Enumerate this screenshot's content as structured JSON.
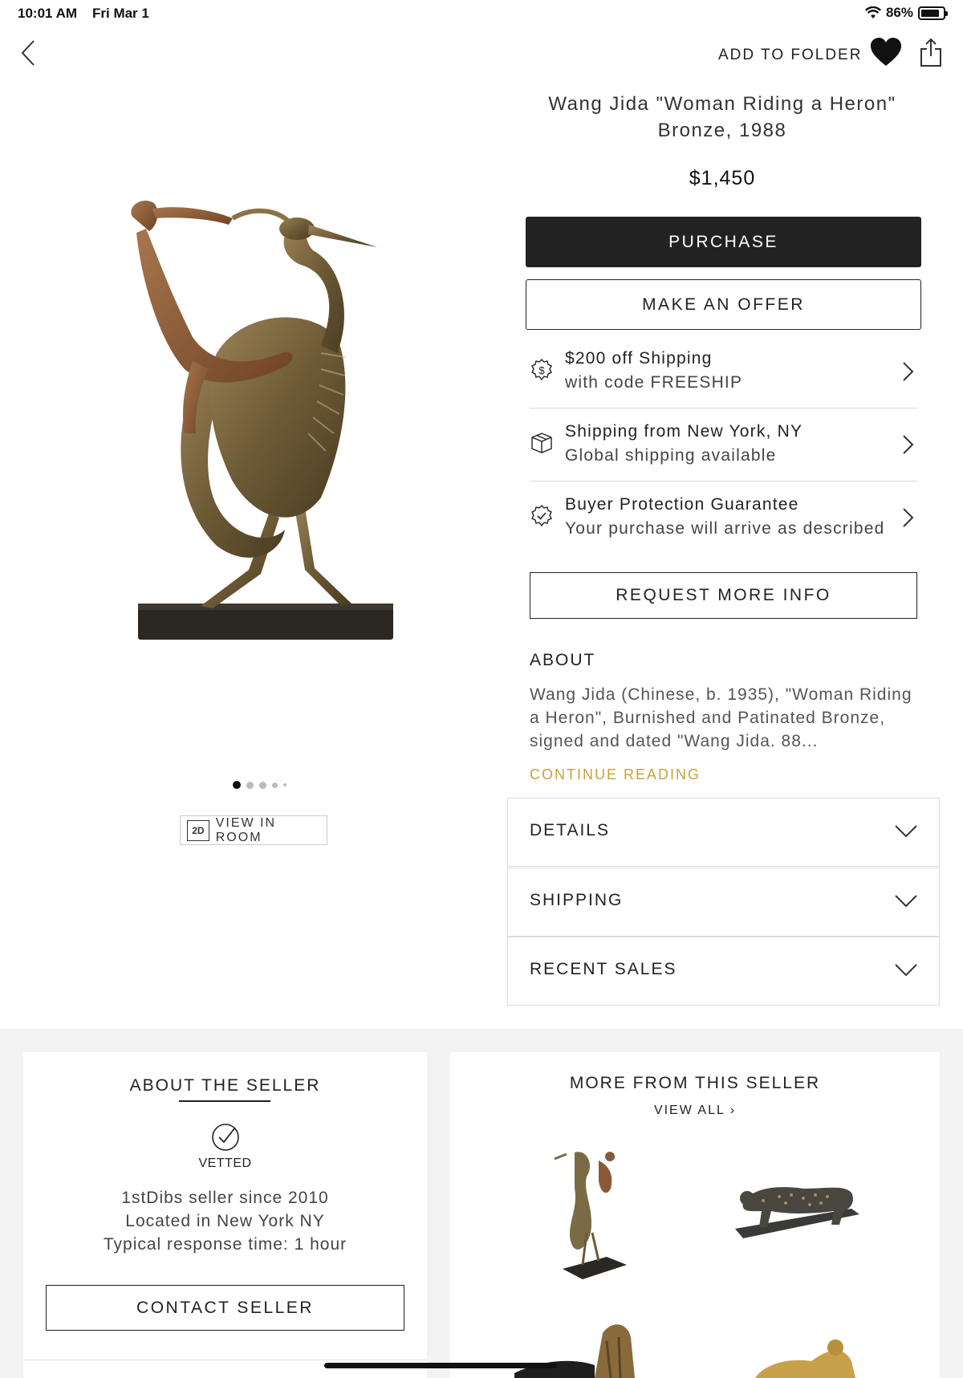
{
  "status_bar": {
    "time": "10:01 AM",
    "date": "Fri Mar 1",
    "battery": "86%",
    "battery_level": 0.86
  },
  "nav": {
    "add_to_folder": "ADD TO FOLDER",
    "back_icon": "chevron-left-icon",
    "favorite_icon": "heart-icon",
    "share_icon": "share-icon"
  },
  "product": {
    "title_line1": "Wang Jida \"Woman Riding a Heron\"",
    "title_line2": "Bronze, 1988",
    "price": "$1,450",
    "purchase_label": "PURCHASE",
    "offer_label": "MAKE AN OFFER"
  },
  "gallery": {
    "page_count": 5,
    "active_index": 0,
    "view_in_room_badge": "2D",
    "view_in_room_label": "VIEW IN ROOM"
  },
  "info_rows": [
    {
      "icon": "dollar-badge-icon",
      "title": "$200 off Shipping",
      "subtitle": "with code FREESHIP"
    },
    {
      "icon": "box-icon",
      "title": "Shipping from New York, NY",
      "subtitle": "Global shipping available"
    },
    {
      "icon": "check-badge-icon",
      "title": "Buyer Protection Guarantee",
      "subtitle": "Your purchase will arrive as described"
    }
  ],
  "request_info_label": "REQUEST MORE INFO",
  "about": {
    "heading": "ABOUT",
    "text": "Wang Jida (Chinese, b. 1935), \"Woman Riding a Heron\", Burnished and Patinated Bronze, signed and dated \"Wang Jida. 88...",
    "continue_label": "CONTINUE READING"
  },
  "accordions": [
    {
      "label": "DETAILS"
    },
    {
      "label": "SHIPPING"
    },
    {
      "label": "RECENT SALES"
    }
  ],
  "seller": {
    "heading": "ABOUT THE SELLER",
    "vetted_label": "VETTED",
    "since": "1stDibs seller since 2010",
    "location": "Located in New York NY",
    "response_time": "Typical response time: 1 hour",
    "contact_label": "CONTACT SELLER"
  },
  "more_from_seller": {
    "heading": "MORE FROM THIS SELLER",
    "view_all_label": "VIEW ALL"
  },
  "colors": {
    "accent_gold": "#c6a238",
    "primary_dark": "#222222",
    "section_gray": "#f3f3f3"
  }
}
